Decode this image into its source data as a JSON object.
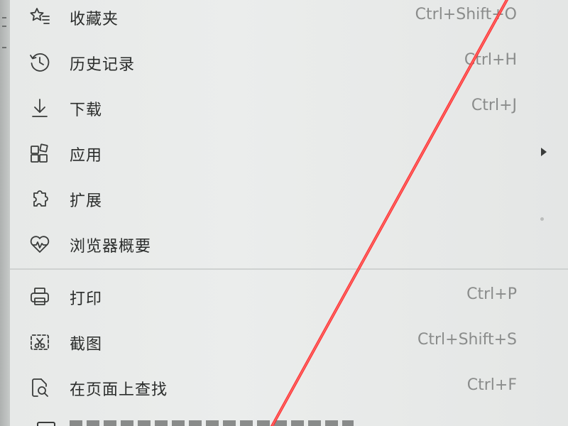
{
  "menu": {
    "items": [
      {
        "label": "收藏夹",
        "shortcut": "Ctrl+Shift+O",
        "icon": "star-list-icon",
        "submenu": false
      },
      {
        "label": "历史记录",
        "shortcut": "Ctrl+H",
        "icon": "history-icon",
        "submenu": false
      },
      {
        "label": "下载",
        "shortcut": "Ctrl+J",
        "icon": "download-icon",
        "submenu": false
      },
      {
        "label": "应用",
        "shortcut": "",
        "icon": "apps-icon",
        "submenu": true
      },
      {
        "label": "扩展",
        "shortcut": "",
        "icon": "extensions-icon",
        "submenu": false
      },
      {
        "label": "浏览器概要",
        "shortcut": "",
        "icon": "heart-pulse-icon",
        "submenu": false
      },
      {
        "label": "打印",
        "shortcut": "Ctrl+P",
        "icon": "print-icon",
        "submenu": false
      },
      {
        "label": "截图",
        "shortcut": "Ctrl+Shift+S",
        "icon": "screenshot-icon",
        "submenu": false
      },
      {
        "label": "在页面上查找",
        "shortcut": "Ctrl+F",
        "icon": "find-in-page-icon",
        "submenu": false
      }
    ]
  },
  "colors": {
    "menu_background": "#e9ebea",
    "text": "#2a2c2b",
    "shortcut_text": "#8a8c8b",
    "laser": "#ff2a2a"
  }
}
